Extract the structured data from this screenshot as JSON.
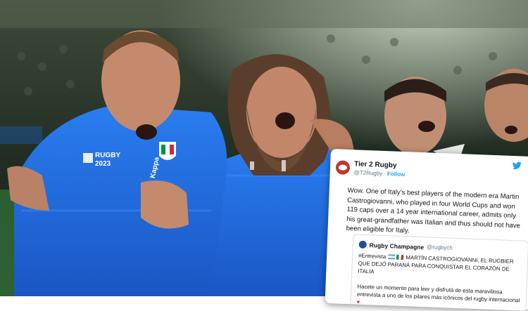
{
  "photo": {
    "jersey_text": "RUGBY",
    "jersey_year": "2023",
    "sponsor": "Kappa"
  },
  "tweet": {
    "author_name": "Tier 2 Rugby",
    "author_handle": "@T2Rugby",
    "separator": "·",
    "follow_label": "Follow",
    "text": "Wow. One of Italy's best players of the modern era Martin Castrogiovanni, who played in four World Cups and won 119 caps over a 14 year international career, admits only his great-grandfather was Italian and thus should not have been eligible for Italy.",
    "quoted": {
      "author_name": "Rugby Champagne",
      "author_handle": "@rugbych",
      "line1_prefix": "#Entrevista",
      "line1_text": "MARTÍN CASTROGIOVANNI, EL RUGBIER QUE DEJÓ PARANÁ PARA CONQUISTAR EL CORAZÓN DE ITALIA",
      "line2": "Hacete un momento para leer y disfrutá de esta maravillosa entrevista a uno de los pilares más icónicos del rugby internacional",
      "heart": "♥"
    }
  },
  "colors": {
    "jersey_blue": "#1f6fe0",
    "twitter_blue": "#1da1f2",
    "pitch_green": "#2e6b33"
  },
  "icons": [
    "twitter-bird-icon",
    "italy-crest-icon",
    "rugby-world-cup-logo"
  ]
}
